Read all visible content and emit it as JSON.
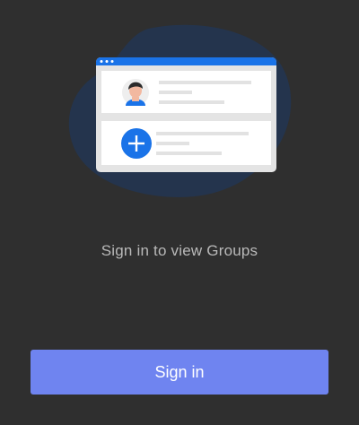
{
  "empty_state": {
    "message": "Sign in to view Groups"
  },
  "actions": {
    "sign_in_label": "Sign in"
  },
  "illustration": {
    "icons": [
      "group-card-illustration",
      "user-avatar-icon",
      "add-circle-icon"
    ]
  },
  "colors": {
    "background": "#2f2f2f",
    "blob": "#24344d",
    "accent_blue": "#1a73e8",
    "button": "#6f84f0",
    "message_text": "#b9b9b9"
  }
}
